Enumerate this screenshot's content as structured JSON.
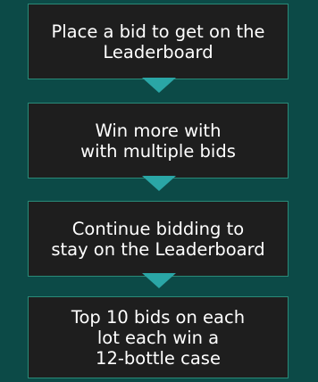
{
  "steps": [
    {
      "text": "Place a bid to get on the\nLeaderboard"
    },
    {
      "text": "Win more with\nwith multiple bids"
    },
    {
      "text": "Continue bidding to\nstay on the Leaderboard"
    },
    {
      "text": "Top 10 bids on each\nlot each win a\n12-bottle case"
    }
  ],
  "colors": {
    "background": "#0c4a47",
    "box_fill": "#1e1e1e",
    "box_border": "#2a8a78",
    "arrow": "#2aa6a6",
    "text": "#ffffff"
  }
}
